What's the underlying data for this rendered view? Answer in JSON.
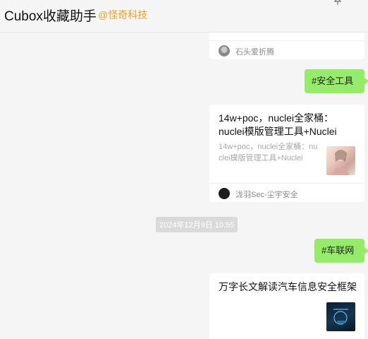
{
  "header": {
    "title": "Cubox收藏助手",
    "subtitle": "@怪奇科技",
    "pin_icon": "pin-icon"
  },
  "messages": {
    "card1": {
      "source": "石头爱折腾"
    },
    "bubble1": {
      "text": "#安全工具"
    },
    "card2": {
      "title": "14w+poc，nuclei全家桶：nuclei模版管理工具+Nuclei",
      "description": "14w+poc，nuclei全家桶：nuclei模版管理工具+Nuclei",
      "source": "泷羽Sec-尘宇安全"
    },
    "timestamp": "2024年12月9日 10:55",
    "bubble2": {
      "text": "#车联网"
    },
    "card3": {
      "title": "万字长文解读汽车信息安全框架"
    }
  },
  "colors": {
    "bubble": "#95ec69",
    "subtitle": "#f0a020",
    "background": "#f5f5f5"
  }
}
